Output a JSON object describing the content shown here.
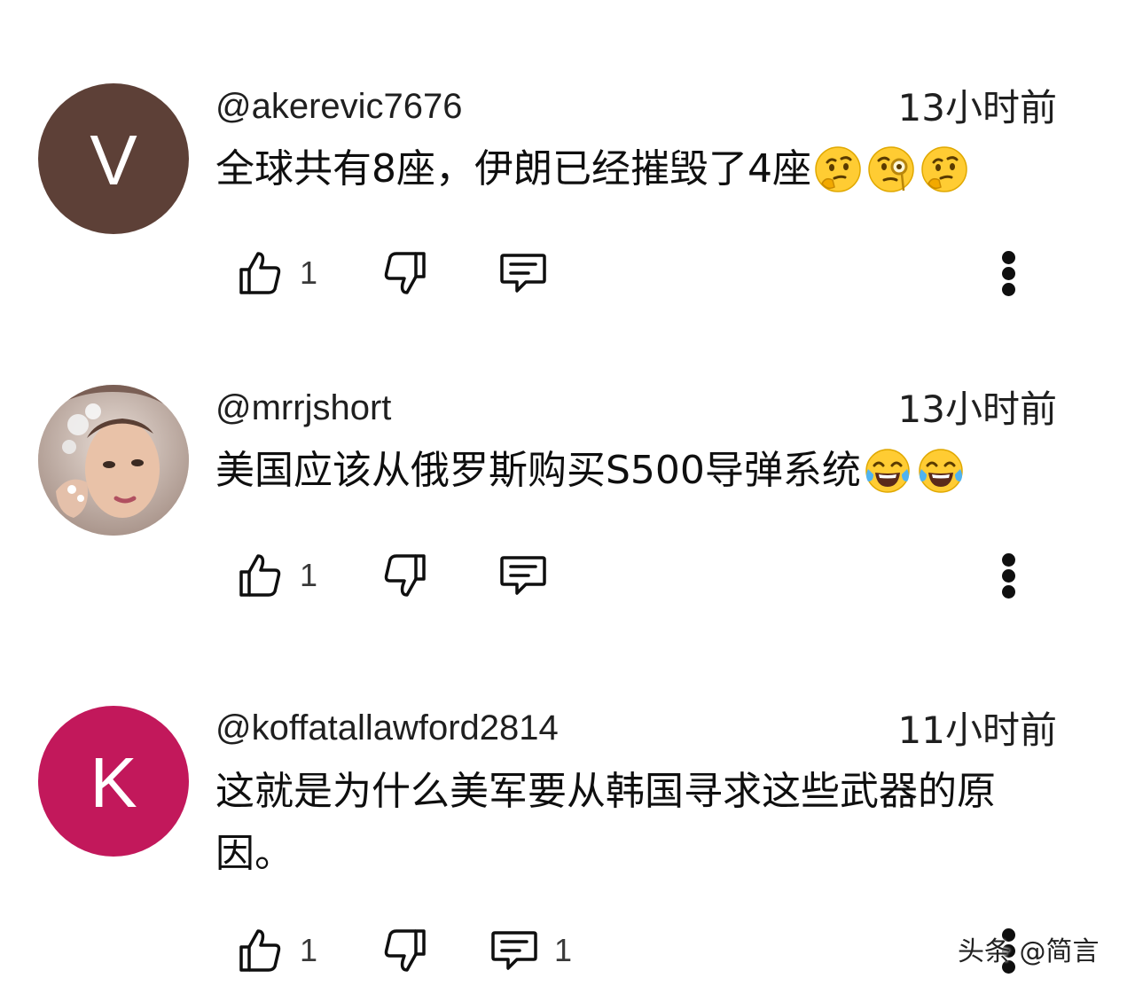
{
  "comments": [
    {
      "avatar_letter": "V",
      "avatar_color": "#5d4037",
      "handle": "@akerevic7676",
      "time": "13小时前",
      "text": "全球共有8座，伊朗已经摧毁了4座",
      "emojis": [
        "thinking-face",
        "face-with-monocle",
        "thinking-face"
      ],
      "likes": "1",
      "replies": ""
    },
    {
      "avatar_letter": "",
      "avatar_color": "#c9b8ad",
      "handle": "@mrrjshort",
      "time": "13小时前",
      "text": "美国应该从俄罗斯购买S500导弹系统",
      "emojis": [
        "tears-of-joy-face",
        "tears-of-joy-face"
      ],
      "likes": "1",
      "replies": ""
    },
    {
      "avatar_letter": "K",
      "avatar_color": "#c2185b",
      "handle": "@koffatallawford2814",
      "time": "11小时前",
      "text": "这就是为什么美军要从韩国寻求这些武器的原因。",
      "emojis": [],
      "likes": "1",
      "replies": "1"
    }
  ],
  "watermark": "头条 @简言"
}
